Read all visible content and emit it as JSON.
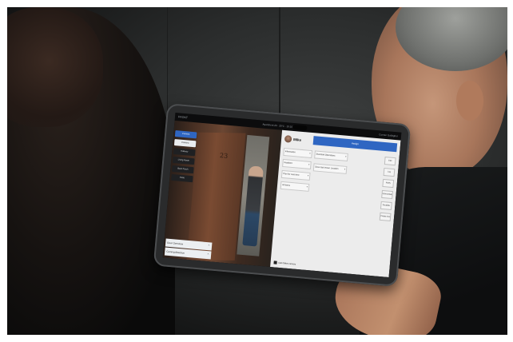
{
  "tablet_ui": {
    "status_bar": {
      "left": "FRONT",
      "center": "Apartment 23 · 20°C · 10:10",
      "right": "Conner Gallagher"
    },
    "camera_menu": [
      {
        "label": "Camera",
        "state": "active"
      },
      {
        "label": "Camera",
        "state": "highlight"
      },
      {
        "label": "Hallway",
        "state": "normal"
      },
      {
        "label": "Living Room",
        "state": "normal"
      },
      {
        "label": "Back Porch",
        "state": "normal"
      },
      {
        "label": "Patio",
        "state": "normal"
      }
    ],
    "door_number": "23",
    "bottom_panel": {
      "row1": "Door Overview",
      "row2": "Coming Attention"
    },
    "side_panel": {
      "user_name": "Mike",
      "primary_button": "Assign",
      "fields_left": [
        "Information",
        "Resident",
        "Plan for next time",
        "All Items"
      ],
      "fields_mid": [
        "Standard Operations",
        "Save last known Location"
      ],
      "buttons": [
        "Edit",
        "Log",
        "Notify",
        "Acknowledge",
        "Escalate",
        "Create Incident"
      ],
      "checkbox_label": "Auto follow camera"
    }
  }
}
